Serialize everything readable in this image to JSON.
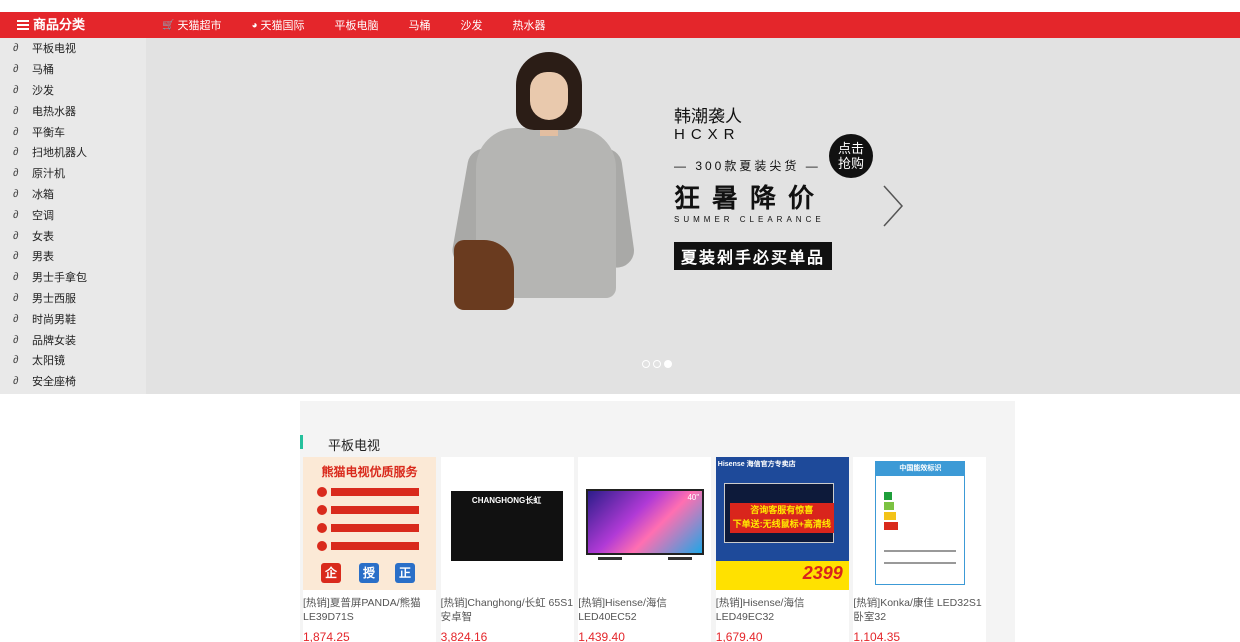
{
  "topnav": {
    "category_title": "商品分类",
    "links": [
      {
        "label": "天猫超市",
        "icon": "cart-icon"
      },
      {
        "label": "天猫国际",
        "icon": "globe-icon"
      },
      {
        "label": "平板电脑"
      },
      {
        "label": "马桶"
      },
      {
        "label": "沙发"
      },
      {
        "label": "热水器"
      }
    ]
  },
  "sidebar": {
    "items": [
      "平板电视",
      "马桶",
      "沙发",
      "电热水器",
      "平衡车",
      "扫地机器人",
      "原汁机",
      "冰箱",
      "空调",
      "女表",
      "男表",
      "男士手拿包",
      "男士西服",
      "时尚男鞋",
      "品牌女装",
      "太阳镜",
      "安全座椅"
    ]
  },
  "banner": {
    "title_cn": "韩潮袭人",
    "title_en": "HCXR",
    "sub": "— 300款夏装尖货 —",
    "headline": "狂暑降价",
    "headline_en": "SUMMER CLEARANCE",
    "cta": "夏装剁手必买单品",
    "badge_line1": "点击",
    "badge_line2": "抢购",
    "active_slide": 3,
    "slide_count": 3
  },
  "products": {
    "section_title": "平板电视",
    "items": [
      {
        "name": "[热销]夏普屏PANDA/熊猫 LE39D71S",
        "price": "1,874.25"
      },
      {
        "name": "[热销]Changhong/长虹 65S1 安卓智",
        "price": "3,824.16"
      },
      {
        "name": "[热销]Hisense/海信 LED40EC52",
        "price": "1,439.40"
      },
      {
        "name": "[热销]Hisense/海信 LED49EC32",
        "price": "1,679.40"
      },
      {
        "name": "[热销]Konka/康佳 LED32S1卧室32",
        "price": "1,104.35"
      }
    ],
    "thumb_text": {
      "t1_title": "熊猫电视优质服务",
      "t1_seals": [
        "企",
        "授",
        "正"
      ],
      "t2_logo": "CHANGHONG长虹",
      "t3_size": "40\"",
      "t4_brand": "Hisense 海信官方专卖店",
      "t4_line1": "咨询客服有惊喜",
      "t4_line2": "下单送:无线鼠标+高清线",
      "t4_price": "2399",
      "t5_head": "中国能效标识"
    }
  }
}
